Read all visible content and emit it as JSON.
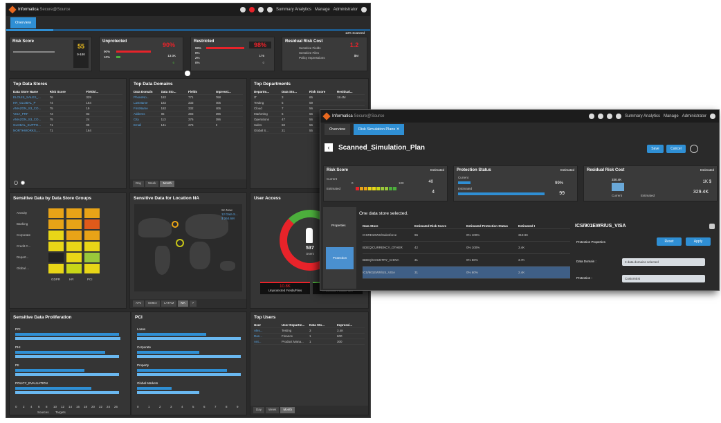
{
  "w1": {
    "title": "Informatica",
    "subtitle": "Secure@Source",
    "nav": [
      "Summary Analytics",
      "Manage",
      "Administrator"
    ],
    "tab": "Overview",
    "scanned": "13% Scanned",
    "kpis": {
      "risk": {
        "title": "Risk Score",
        "value": "55",
        "range": "0-100"
      },
      "unprot": {
        "title": "Unprotected",
        "pct": "90%",
        "r1": "90%",
        "r2": "10%",
        "value": "13.0K",
        "badge": "6"
      },
      "restr": {
        "title": "Restricted",
        "pct": "98%",
        "r1": "98%",
        "r2": "0%",
        "r3": "2%",
        "r4": "0%",
        "value": "176",
        "badge": "0"
      },
      "resid": {
        "title": "Residual Risk Cost",
        "value": "1.2",
        "items": [
          "Sensitive Fields",
          "Sensitive Files",
          "Policy Impressions"
        ],
        "sub": "$M"
      }
    },
    "stores": {
      "title": "Top Data Stores",
      "cols": [
        "Data Store Name",
        "Risk Score",
        "Fields/..."
      ],
      "rows": [
        [
          "ELOUIS_SALES_...",
          "76",
          "329"
        ],
        [
          "HR_GLOBAL_P",
          "74",
          "164"
        ],
        [
          "AMAZON_S3_CO...",
          "75",
          "19"
        ],
        [
          "VISA_PRF",
          "73",
          "83"
        ],
        [
          "AMAZON_S3_CO...",
          "75",
          "24"
        ],
        [
          "GLOBAL_SUPPO...",
          "71",
          "85"
        ],
        [
          "NORTHWORKS_...",
          "71",
          "164"
        ]
      ]
    },
    "domains": {
      "title": "Top Data Domains",
      "cols": [
        "Data Domain",
        "Data Sto...",
        "Fields",
        "Impressi..."
      ],
      "rows": [
        [
          "PhoneNo...",
          "182",
          "771",
          "768"
        ],
        [
          "LastName",
          "182",
          "333",
          "405"
        ],
        [
          "FirstName",
          "182",
          "332",
          "406"
        ],
        [
          "Address",
          "86",
          "393",
          "396"
        ],
        [
          "City",
          "113",
          "376",
          "396"
        ],
        [
          "Email",
          "141",
          "376",
          "8"
        ]
      ],
      "tabs": [
        "Day",
        "Week",
        "Month"
      ]
    },
    "depts": {
      "title": "Top Departments",
      "cols": [
        "Departm...",
        "Data Sto...",
        "Risk Score",
        "Residual..."
      ],
      "rows": [
        [
          "IT",
          "3",
          "65",
          "18.4M"
        ],
        [
          "Testing",
          "5",
          "59",
          ""
        ],
        [
          "Cloud",
          "7",
          "56",
          ""
        ],
        [
          "Marketing",
          "6",
          "56",
          ""
        ],
        [
          "Operations",
          "47",
          "56",
          ""
        ],
        [
          "Sales",
          "60",
          "56",
          ""
        ],
        [
          "Global S...",
          "21",
          "55",
          ""
        ]
      ]
    },
    "groups": {
      "title": "Sensitive Data by Data Store Groups",
      "rows": [
        "Annuity",
        "Banking",
        "Corporate",
        "Credit C...",
        "Depart...",
        "Global ..."
      ],
      "cols": [
        "GDPR",
        "HR",
        "PCI"
      ]
    },
    "location": {
      "title": "Sensitive Data for Location NA",
      "legend": [
        "Sn Now",
        "12 Data S...",
        "$ 264.6M"
      ],
      "tabs": [
        "APJ",
        "EMEA",
        "LATAM",
        "NA",
        "?"
      ]
    },
    "access": {
      "title": "User Access",
      "center": "537",
      "centerSub": "Users",
      "b1val": "10.8K",
      "b1": "Unprotected Fields/Files",
      "b2": "Protected Fields/Files"
    },
    "prolif": {
      "title": "Sensitive Data Proliferation",
      "rows": [
        "PCI",
        "PHI",
        "PII",
        "POLICY_EVALUATION"
      ],
      "axis": [
        "0",
        "2",
        "4",
        "6",
        "8",
        "10",
        "12",
        "14",
        "16",
        "18",
        "20",
        "22",
        "24",
        "26"
      ],
      "legend": [
        "Sources",
        "Targets"
      ]
    },
    "pci": {
      "title": "PCI",
      "rows": [
        "Loans",
        "Corporate",
        "Property",
        "Global Markets"
      ],
      "axis": [
        "0",
        "1",
        "2",
        "3",
        "4",
        "5",
        "6",
        "7",
        "8",
        "9"
      ]
    },
    "users": {
      "title": "Top Users",
      "cols": [
        "User",
        "User Departm...",
        "Data Sto...",
        "Impressi..."
      ],
      "rows": [
        [
          "Alex...",
          "Testing",
          "3",
          "3.4K"
        ],
        [
          "Dan...",
          "Finance",
          "1",
          "600"
        ],
        [
          "Ant...",
          "Product Mana...",
          "1",
          "300"
        ]
      ],
      "tabs": [
        "Day",
        "Week",
        "Month"
      ]
    }
  },
  "w2": {
    "title": "Informatica",
    "subtitle": "Secure@Source",
    "nav": [
      "Summary Analytics",
      "Manage",
      "Administrator"
    ],
    "tabs": [
      "Overview",
      "Risk Simulation Plans"
    ],
    "plan": "Scanned_Simulation_Plan",
    "save": "Save",
    "cancel": "Cancel",
    "risk": {
      "title": "Risk Score",
      "est": "Estimated",
      "current": "Current",
      "estimated": "Estimated",
      "v1": "40",
      "v2": "4",
      "min": "0",
      "max": "100"
    },
    "prot": {
      "title": "Protection Status",
      "est": "Estimated",
      "current": "Current",
      "estimated": "Estimated",
      "v1": "99%",
      "v2": "99"
    },
    "resid": {
      "title": "Residual Risk Cost",
      "est": "Estimated",
      "v1": "1K $",
      "v2": "329.4K",
      "l1": "Current",
      "l2": "Estimated",
      "bar": "330.4K"
    },
    "side": [
      "Properties",
      "Protection"
    ],
    "msg": "One data store selected.",
    "cols": [
      "Data Store",
      "Estimated Risk Score",
      "Estimated Protection Status",
      "Estimated I"
    ],
    "rows": [
      [
        "ICSRE1DWS/Salesforce",
        "96",
        "0% 100%",
        "318.9K"
      ],
      [
        "BDEQ/CURRENCY_OTHER",
        "42",
        "0% 100%",
        "3.4K"
      ],
      [
        "BDEQ/COUNTRY_CHINA",
        "31",
        "0% 56%",
        "3.7K"
      ],
      [
        "ICS/901EWR/US_VISA",
        "31",
        "0% 60%",
        "2.4K"
      ]
    ],
    "detail": {
      "title": "ICS/901EWR/US_VISA",
      "sub": "Protection Properties",
      "reset": "Reset",
      "apply": "Apply",
      "l1": "Data Domain :",
      "v1": "3 data domains selected",
      "l2": "Protection :",
      "v2": "CustomEst"
    }
  }
}
